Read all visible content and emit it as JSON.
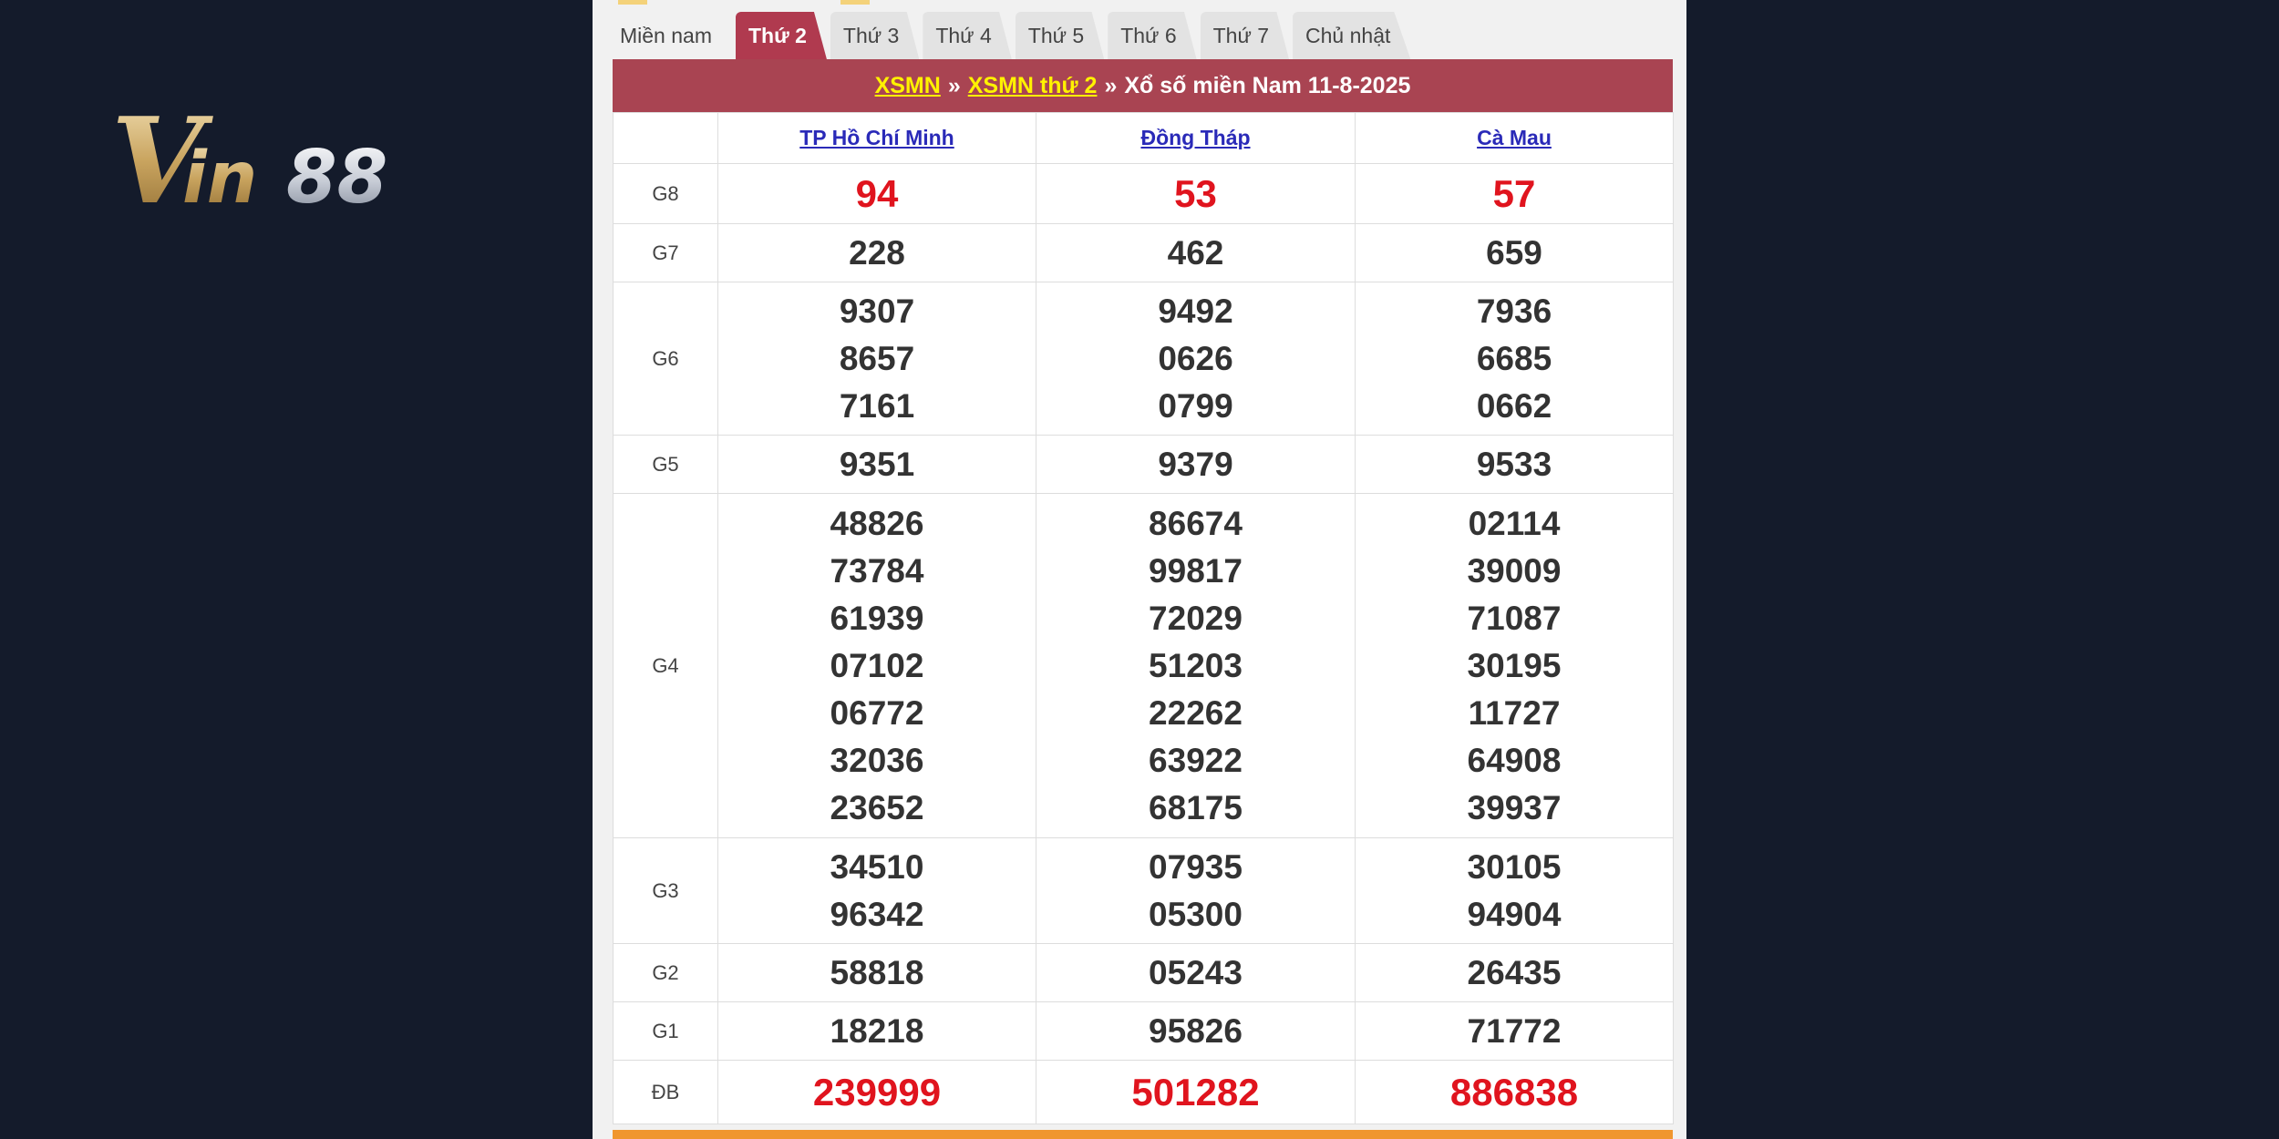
{
  "logo": {
    "text": "Vin88",
    "icon": "vin88-logo"
  },
  "tabs": [
    {
      "label": "Miền nam",
      "active": false
    },
    {
      "label": "Thứ 2",
      "active": true
    },
    {
      "label": "Thứ 3",
      "active": false
    },
    {
      "label": "Thứ 4",
      "active": false
    },
    {
      "label": "Thứ 5",
      "active": false
    },
    {
      "label": "Thứ 6",
      "active": false
    },
    {
      "label": "Thứ 7",
      "active": false
    },
    {
      "label": "Chủ nhật",
      "active": false
    }
  ],
  "title": {
    "link1": "XSMN",
    "sep1": "»",
    "link2": "XSMN thứ 2",
    "sep2": "»",
    "text": "Xổ số miền Nam 11-8-2025"
  },
  "provinces": [
    "TP Hồ Chí Minh",
    "Đồng Tháp",
    "Cà Mau"
  ],
  "prizes": [
    {
      "label": "G8",
      "highlight": true,
      "cols": [
        [
          "94"
        ],
        [
          "53"
        ],
        [
          "57"
        ]
      ]
    },
    {
      "label": "G7",
      "highlight": false,
      "cols": [
        [
          "228"
        ],
        [
          "462"
        ],
        [
          "659"
        ]
      ]
    },
    {
      "label": "G6",
      "highlight": false,
      "cols": [
        [
          "9307",
          "8657",
          "7161"
        ],
        [
          "9492",
          "0626",
          "0799"
        ],
        [
          "7936",
          "6685",
          "0662"
        ]
      ]
    },
    {
      "label": "G5",
      "highlight": false,
      "cols": [
        [
          "9351"
        ],
        [
          "9379"
        ],
        [
          "9533"
        ]
      ]
    },
    {
      "label": "G4",
      "highlight": false,
      "cols": [
        [
          "48826",
          "73784",
          "61939",
          "07102",
          "06772",
          "32036",
          "23652"
        ],
        [
          "86674",
          "99817",
          "72029",
          "51203",
          "22262",
          "63922",
          "68175"
        ],
        [
          "02114",
          "39009",
          "71087",
          "30195",
          "11727",
          "64908",
          "39937"
        ]
      ]
    },
    {
      "label": "G3",
      "highlight": false,
      "cols": [
        [
          "34510",
          "96342"
        ],
        [
          "07935",
          "05300"
        ],
        [
          "30105",
          "94904"
        ]
      ]
    },
    {
      "label": "G2",
      "highlight": false,
      "cols": [
        [
          "58818"
        ],
        [
          "05243"
        ],
        [
          "26435"
        ]
      ]
    },
    {
      "label": "G1",
      "highlight": false,
      "cols": [
        [
          "18218"
        ],
        [
          "95826"
        ],
        [
          "71772"
        ]
      ]
    },
    {
      "label": "ĐB",
      "highlight": true,
      "cols": [
        [
          "239999"
        ],
        [
          "501282"
        ],
        [
          "886838"
        ]
      ]
    }
  ],
  "colors": {
    "background": "#141b2b",
    "title_bar": "#a94452",
    "active_tab": "#b03a4f",
    "highlight_number": "#e0141e",
    "link_yellow": "#fff200",
    "province_link": "#2a2ab8",
    "bottom_bar": "#f0962e"
  }
}
